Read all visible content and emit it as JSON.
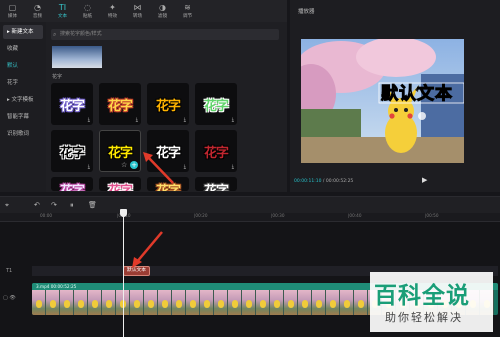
{
  "toolbar": {
    "tabs": [
      {
        "label": "媒体",
        "icon": "▢"
      },
      {
        "label": "音频",
        "icon": "◔"
      },
      {
        "label": "文本",
        "icon": "TI"
      },
      {
        "label": "贴纸",
        "icon": "◌"
      },
      {
        "label": "特效",
        "icon": "✦"
      },
      {
        "label": "转场",
        "icon": "⋈"
      },
      {
        "label": "滤镜",
        "icon": "◑"
      },
      {
        "label": "调节",
        "icon": "≋"
      }
    ]
  },
  "sidebar": {
    "items": [
      "▸ 新建文本",
      "收藏",
      "默认",
      "花字",
      "▸ 文字模板",
      "智能字幕",
      "识别歌词"
    ]
  },
  "panel": {
    "search_placeholder": "搜索花字颜色/样式",
    "section": "花字",
    "cards": [
      {
        "text": "花字",
        "color": "#ffffff",
        "stroke": "#6c5ac9",
        "dl": "⤓"
      },
      {
        "text": "花字",
        "color": "#ffd74a",
        "stroke": "#c0392b",
        "dl": "⤓"
      },
      {
        "text": "花字",
        "color": "#ffb300",
        "stroke": "#000000",
        "dl": "⤓"
      },
      {
        "text": "花字",
        "color": "#5fd36a",
        "stroke": "#ffffff",
        "dl": "⤓"
      },
      {
        "text": "花字",
        "color": "#000000",
        "stroke": "#ffffff",
        "dl": "⤓"
      },
      {
        "text": "花字",
        "color": "#ffea00",
        "stroke": "#000000",
        "dl": ""
      },
      {
        "text": "花字",
        "color": "#ffffff",
        "stroke": "#000000",
        "dl": "⤓"
      },
      {
        "text": "花字",
        "color": "#c0262f",
        "stroke": "#000000",
        "dl": "⤓"
      },
      {
        "text": "花字",
        "color": "#f0e6ff",
        "stroke": "#b33d9a",
        "dl": ""
      },
      {
        "text": "花字",
        "color": "#e04f8c",
        "stroke": "#ffffff",
        "dl": ""
      },
      {
        "text": "花字",
        "color": "#ffe06b",
        "stroke": "#a04a1e",
        "dl": ""
      },
      {
        "text": "花字",
        "color": "#ffffff",
        "stroke": "#444444",
        "dl": ""
      }
    ]
  },
  "player": {
    "title": "播放器",
    "overlay_text": "默认文本",
    "time_current": "00:00:11:10",
    "time_total": "00:00:52:25"
  },
  "timeline": {
    "ticks": [
      "00:00",
      "|00:10",
      "|00:20",
      "|00:30",
      "|00:40",
      "|00:50"
    ],
    "text_clip": "默认文本",
    "text_track": "T1",
    "video_clip_name": "3.mp4",
    "video_clip_duration": "00:00:52:25"
  },
  "watermark": {
    "line1": "百科全说",
    "line2": "助你轻松解决"
  }
}
